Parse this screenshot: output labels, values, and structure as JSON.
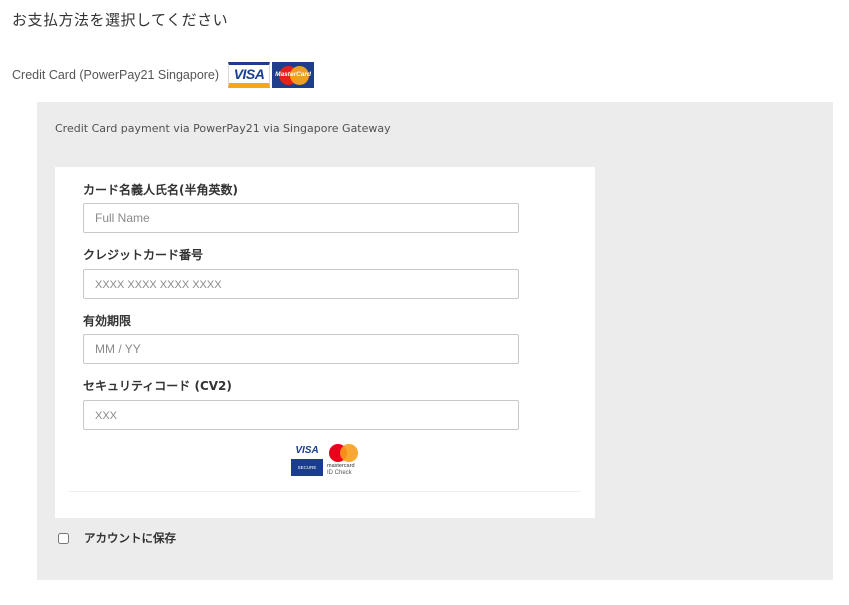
{
  "page": {
    "title": "お支払方法を選択してください"
  },
  "payment_method": {
    "label": "Credit Card (PowerPay21 Singapore)",
    "logos": {
      "visa": "VISA",
      "mastercard": "MasterCard"
    },
    "description": "Credit Card payment via PowerPay21 via Singapore Gateway"
  },
  "form": {
    "name": {
      "label": "カード名義人氏名(半角英数)",
      "placeholder": "Full Name",
      "value": ""
    },
    "card_number": {
      "label": "クレジットカード番号",
      "placeholder": "XXXX XXXX XXXX XXXX",
      "value": ""
    },
    "expiry": {
      "label": "有効期限",
      "placeholder": "MM / YY",
      "value": ""
    },
    "cvv": {
      "label": "セキュリティコード (CV2)",
      "placeholder": "XXX",
      "value": ""
    }
  },
  "secure_badges": {
    "visa": "VISA",
    "visa_sub": "SECURE",
    "mc_name": "mastercard",
    "mc_sub": "ID Check"
  },
  "save": {
    "label": "アカウントに保存",
    "checked": false
  },
  "colors": {
    "panel_bg": "#ececec",
    "visa_blue": "#1a3d8f",
    "visa_gold": "#f7a51c",
    "mc_red": "#eb001b",
    "mc_orange": "#f79e1b"
  }
}
